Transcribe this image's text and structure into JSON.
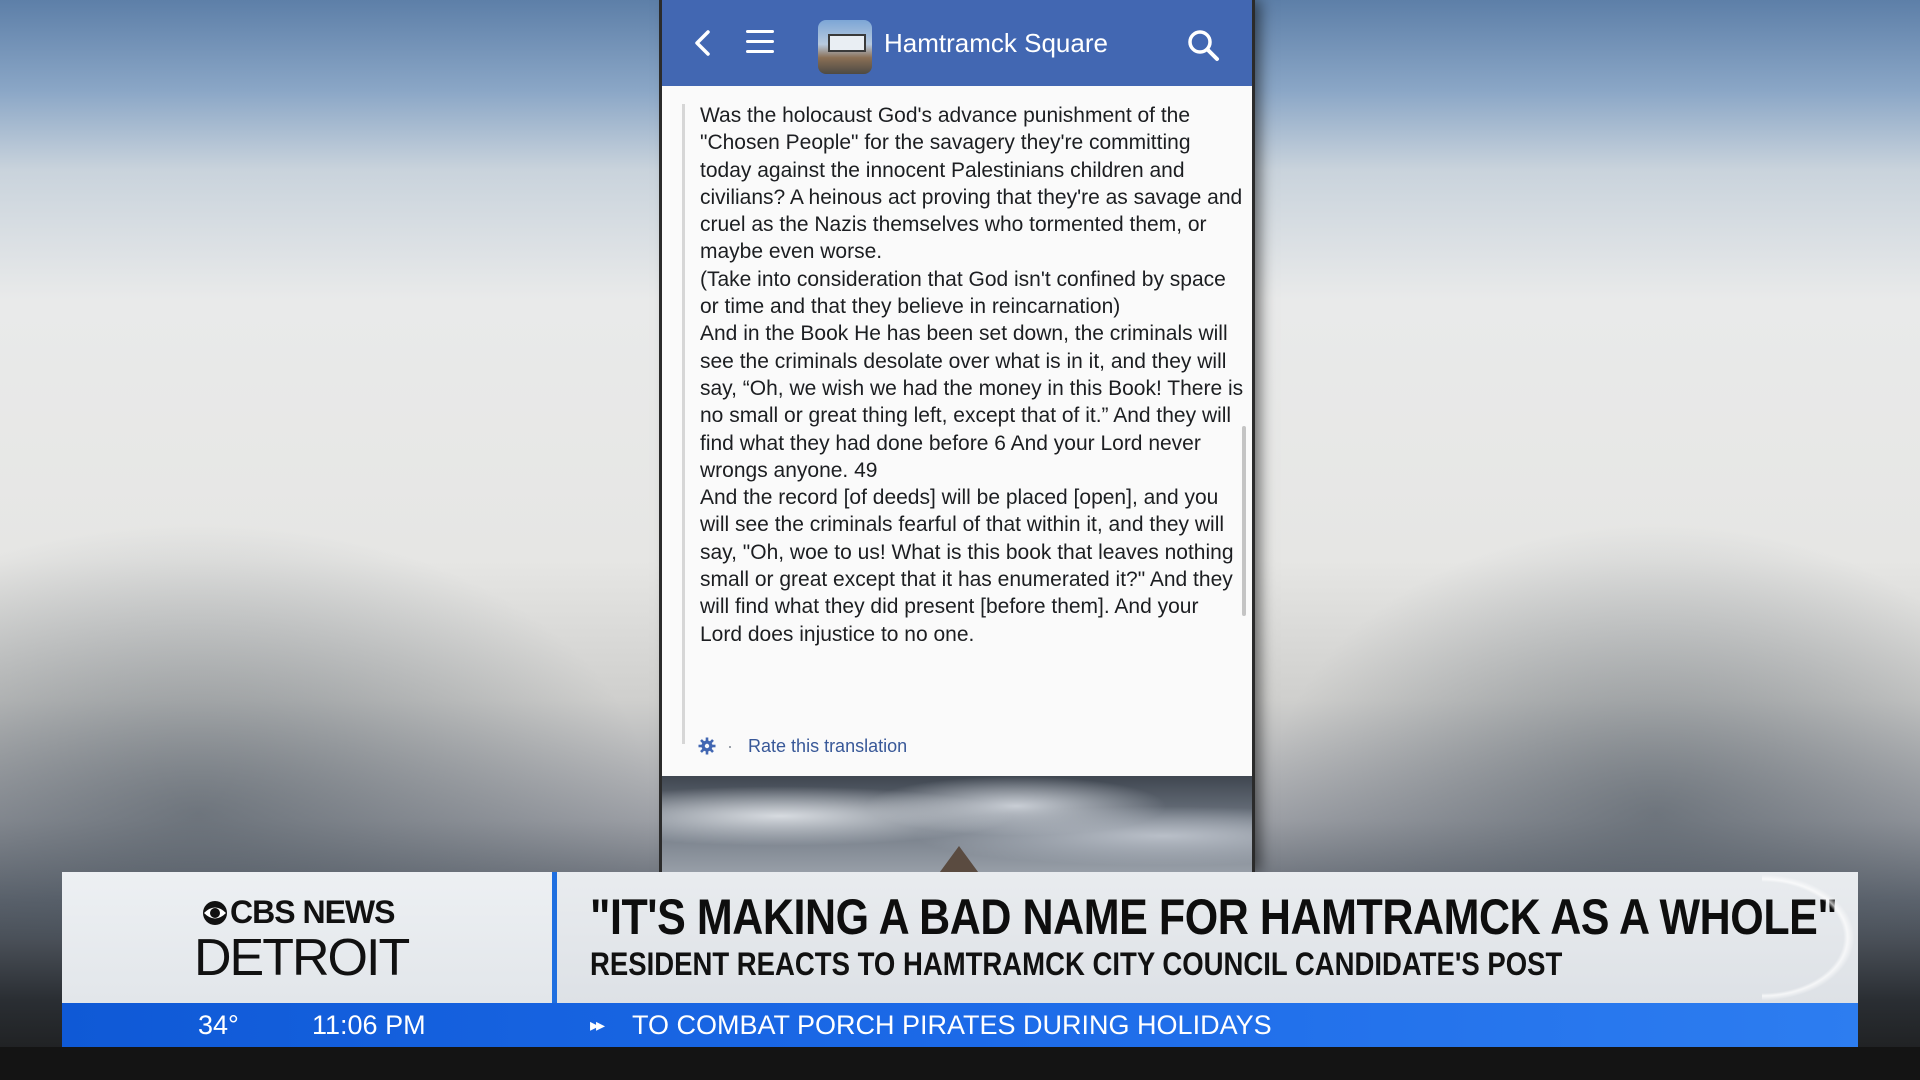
{
  "app": {
    "group_name": "Hamtramck Square"
  },
  "post": {
    "paragraphs": [
      "Was the holocaust God's advance punishment of the \"Chosen People\" for the savagery they're committing today against the innocent Palestinians children and civilians? A heinous act proving that they're as savage and cruel as the Nazis themselves who tormented them, or maybe even worse.",
      "(Take into consideration that God isn't confined by space or time and that they believe in reincarnation)",
      "And in the Book He has been set down, the criminals will see the criminals desolate over what is in it, and they will say, “Oh, we wish we had the money in this Book! There is no small or great thing left, except that of it.” And they will find what they had done before 6 And your Lord never wrongs anyone. 49",
      "And the record [of deeds] will be placed [open], and you will see the criminals fearful of that within it, and they will say, \"Oh, woe to us! What is this book that leaves nothing small or great except that it has enumerated it?\" And they will find what they did present [before them]. And your Lord does injustice to no one."
    ],
    "rate_link": "Rate this translation",
    "separator": "·"
  },
  "broadcast": {
    "network": "CBS NEWS",
    "market": "DETROIT",
    "headline": "\"IT'S MAKING A BAD NAME FOR HAMTRAMCK AS A WHOLE\"",
    "subhead": "RESIDENT REACTS TO HAMTRAMCK CITY COUNCIL CANDIDATE'S POST",
    "temperature": "34°",
    "time": "11:06 PM",
    "ticker_arrow": "▸▸",
    "ticker_text": "TO COMBAT PORCH PIRATES DURING HOLIDAYS"
  },
  "colors": {
    "facebook_blue": "#4267b2",
    "ticker_blue": "#1c6ae8",
    "link_blue": "#385898"
  },
  "icons": [
    "back-arrow-icon",
    "hamburger-menu-icon",
    "search-icon",
    "gear-icon",
    "cbs-eye-icon"
  ]
}
